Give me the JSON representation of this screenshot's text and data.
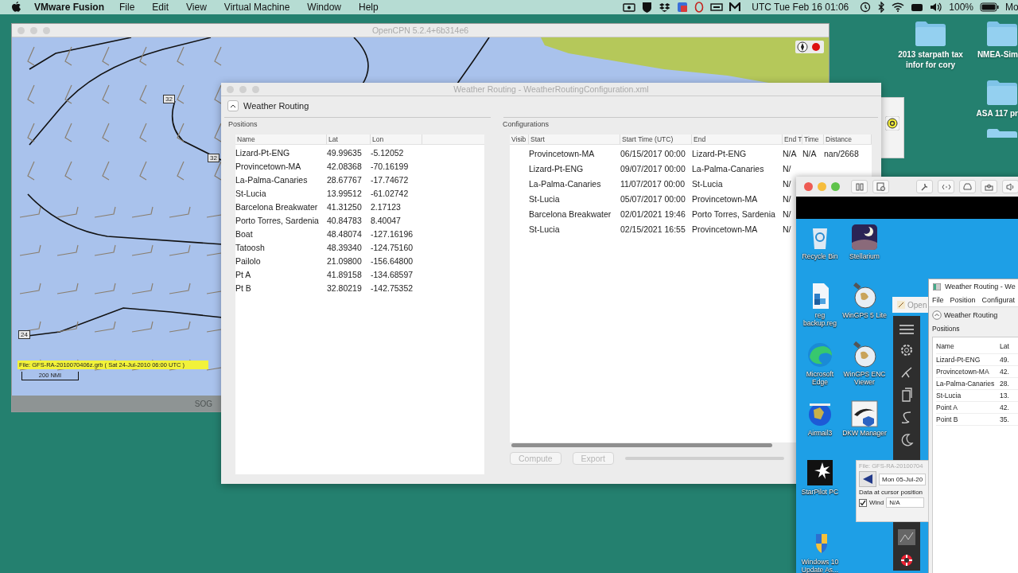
{
  "menubar": {
    "app": "VMware Fusion",
    "menus": [
      "File",
      "Edit",
      "View",
      "Virtual Machine",
      "Window",
      "Help"
    ],
    "clock": "UTC Tue Feb 16 01:06",
    "battery": "100%",
    "user": "Mo"
  },
  "desktop_folders": [
    {
      "label": "2013 starpath tax infor for cory"
    },
    {
      "label": "NMEA-Sim"
    },
    {
      "label": "ASA 117 pr"
    }
  ],
  "chart_window": {
    "title": "OpenCPN 5.2.4+6b314e6",
    "contour_labels": [
      "32",
      "32",
      "24"
    ],
    "grib_label": "File: GFS-RA-2010070406z.grb ( Sat 24-Jul-2010 06:00  UTC )",
    "scale": "200 NMI",
    "status": "SOG"
  },
  "routing_window": {
    "title": "Weather Routing - WeatherRoutingConfiguration.xml",
    "header": "Weather Routing",
    "positions": {
      "title": "Positions",
      "columns": [
        "Name",
        "Lat",
        "Lon"
      ],
      "rows": [
        [
          "Lizard-Pt-ENG",
          "49.99635",
          "-5.12052"
        ],
        [
          "Provincetown-MA",
          "42.08368",
          "-70.16199"
        ],
        [
          "La-Palma-Canaries",
          "28.67767",
          "-17.74672"
        ],
        [
          "St-Lucia",
          "13.99512",
          "-61.02742"
        ],
        [
          "Barcelona Breakwater",
          "41.31250",
          "2.17123"
        ],
        [
          "Porto Torres, Sardenia",
          "40.84783",
          "8.40047"
        ],
        [
          "Boat",
          "48.48074",
          "-127.16196"
        ],
        [
          "Tatoosh",
          "48.39340",
          "-124.75160"
        ],
        [
          "Pailolo",
          "21.09800",
          "-156.64800"
        ],
        [
          "Pt A",
          "41.89158",
          "-134.68597"
        ],
        [
          "Pt B",
          "32.80219",
          "-142.75352"
        ]
      ]
    },
    "configurations": {
      "title": "Configurations",
      "columns": [
        "Visib",
        "Start",
        "Start Time (UTC)",
        "End",
        "End T",
        "Time",
        "Distance"
      ],
      "rows": [
        [
          "",
          "Provincetown-MA",
          "06/15/2017 00:00",
          "Lizard-Pt-ENG",
          "N/A",
          "N/A",
          "nan/2668"
        ],
        [
          "",
          "Lizard-Pt-ENG",
          "09/07/2017 00:00",
          "La-Palma-Canaries",
          "N/"
        ],
        [
          "",
          "La-Palma-Canaries",
          "11/07/2017 00:00",
          "St-Lucia",
          "N/"
        ],
        [
          "",
          "St-Lucia",
          "05/07/2017 00:00",
          "Provincetown-MA",
          "N/"
        ],
        [
          "",
          "Barcelona Breakwater",
          "02/01/2021 19:46",
          "Porto Torres, Sardenia",
          "N/"
        ],
        [
          "",
          "St-Lucia",
          "02/15/2021 16:55",
          "Provincetown-MA",
          "N/"
        ]
      ]
    },
    "buttons": [
      {
        "label": "Compute",
        "disabled": true
      },
      {
        "label": "Export",
        "disabled": true
      }
    ]
  },
  "vm_window": {
    "desktop_icons": [
      {
        "label": "Recycle Bin",
        "kind": "bin"
      },
      {
        "label": "Stellarium",
        "kind": "night"
      },
      {
        "label": "reg backup.reg",
        "kind": "cubes"
      },
      {
        "label": "WinGPS 5 Lite",
        "kind": "satellite"
      },
      {
        "label": "Microsoft Edge",
        "kind": "swirl"
      },
      {
        "label": "WinGPS ENC Viewer",
        "kind": "satellite"
      },
      {
        "label": "Airmail3",
        "kind": "globe"
      },
      {
        "label": "DKW Manager",
        "kind": "bird"
      },
      {
        "label": "StarPilot PC",
        "kind": "star"
      },
      {
        "label": "Windows 10 Update As...",
        "kind": "shield"
      }
    ],
    "inner_tab": "Open",
    "routing": {
      "title": "Weather Routing - We",
      "menus": [
        "File",
        "Position",
        "Configurat"
      ],
      "header": "Weather Routing",
      "positions_title": "Positions",
      "columns": [
        "Name",
        "Lat"
      ],
      "rows": [
        [
          "Lizard-Pt-ENG",
          "49."
        ],
        [
          "Provincetown-MA",
          "42."
        ],
        [
          "La-Palma-Canaries",
          "28."
        ],
        [
          "St-Lucia",
          "13."
        ],
        [
          "Point A",
          "42."
        ],
        [
          "Point B",
          "35."
        ]
      ]
    },
    "grib_popup": {
      "file": "File: GFS-RA-20100704",
      "date": "Mon 05-Jul-20",
      "caption": "Data at cursor position",
      "wind_label": "Wind",
      "wind_checked": true,
      "wind_value": "N/A"
    }
  }
}
